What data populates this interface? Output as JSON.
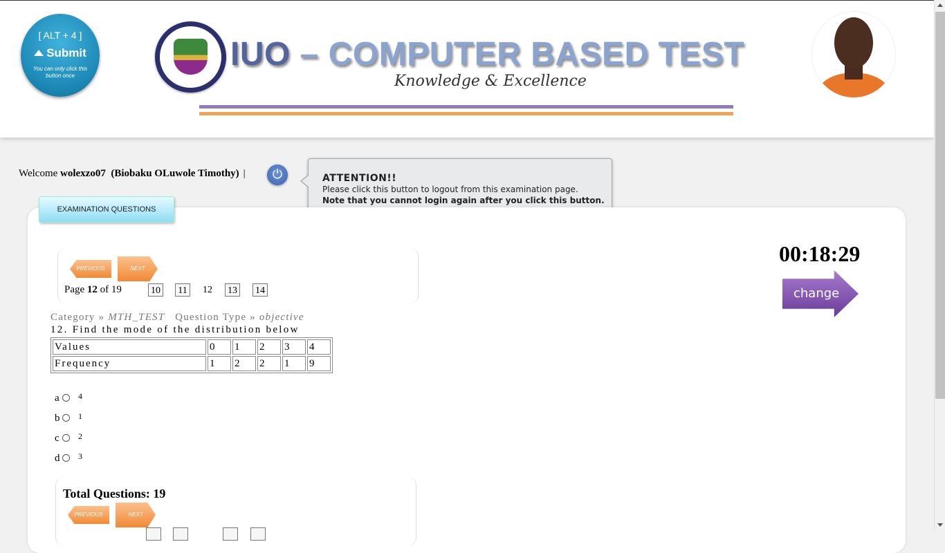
{
  "header": {
    "submit_keys": "[ ALT + 4 ]",
    "submit_label": "Submit",
    "submit_note": "You can only click this button once",
    "title_part1": "IUO",
    "title_part2": " – COMPUTER BASED TEST",
    "slogan": "Knowledge & Excellence"
  },
  "welcome": {
    "prefix": "Welcome ",
    "username": "wolexzo07",
    "fullname": "(Biobaku OLuwole Timothy)",
    "separator": "|"
  },
  "tooltip": {
    "title": "ATTENTION!!",
    "line1": "Please click this button to logout from this examination page.",
    "line2": "Note that you cannot login again after you click this button."
  },
  "tab": {
    "label": "EXAMINATION QUESTIONS"
  },
  "nav": {
    "previous_label": "PREVIOUS",
    "next_label": "NEXT",
    "page_prefix": "Page ",
    "current_page": "12",
    "page_suffix": " of 19",
    "pages": [
      "10",
      "11",
      "12",
      "13",
      "14"
    ]
  },
  "question": {
    "category_label": "Category » ",
    "category_value": "MTH_TEST",
    "type_label": "Question Type » ",
    "type_value": "objective",
    "text": "12. Find the mode of the distribution below",
    "table": {
      "rows": [
        {
          "label": "Values",
          "cells": [
            "0",
            "1",
            "2",
            "3",
            "4"
          ]
        },
        {
          "label": "Frequency",
          "cells": [
            "1",
            "2",
            "2",
            "1",
            "9"
          ]
        }
      ]
    },
    "options": [
      {
        "letter": "a",
        "value": "4"
      },
      {
        "letter": "b",
        "value": "1"
      },
      {
        "letter": "c",
        "value": "2"
      },
      {
        "letter": "d",
        "value": "3"
      }
    ]
  },
  "timer": {
    "value": "00:18:29"
  },
  "change_label": "change",
  "footer": {
    "total_label": "Total Questions: 19"
  },
  "colors": {
    "accent_orange": "#f08a35",
    "accent_purple": "#6a3b98",
    "tab_blue": "#8fdcf5",
    "submit_blue": "#1b86b4"
  }
}
